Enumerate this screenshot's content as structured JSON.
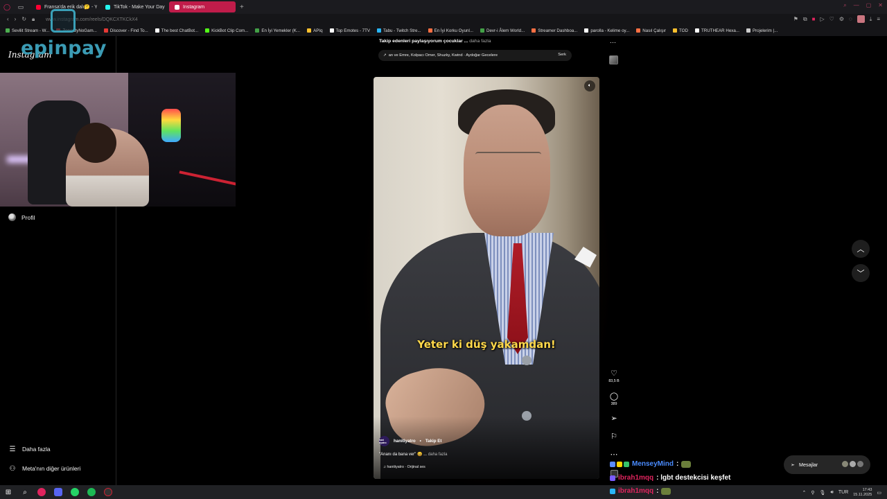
{
  "browser": {
    "tabs": [
      {
        "label": "Fransa'da erik dalı🤔 - Yo",
        "favicon_color": "#ff0033",
        "active": false
      },
      {
        "label": "TikTok - Make Your Day",
        "favicon_color": "#25f4ee",
        "active": false
      },
      {
        "label": "Instagram",
        "favicon_color": "#e1306c",
        "active": true
      }
    ],
    "new_tab": "+",
    "url": "www.instagram.com/reels/DQKCXTKCkX4",
    "bookmarks": [
      {
        "label": "Sevilit Stream - W...",
        "color": "#4caf50"
      },
      {
        "label": "Zone ByNoGam...",
        "color": "#e53935"
      },
      {
        "label": "Discover - Find To...",
        "color": "#e53935"
      },
      {
        "label": "The best ChatBot...",
        "color": "#ffffff"
      },
      {
        "label": "KickBot Clip Com...",
        "color": "#53fc18"
      },
      {
        "label": "En İyi Yemekler (K...",
        "color": "#43a047"
      },
      {
        "label": "APIq",
        "color": "#fbc02d"
      },
      {
        "label": "Top Emotes - 7TV",
        "color": "#ffffff"
      },
      {
        "label": "Tabu - Twitch Stre...",
        "color": "#29b6f6"
      },
      {
        "label": "En İyi Korku Oyunl...",
        "color": "#ff7043"
      },
      {
        "label": "Devr-i Âlem World...",
        "color": "#43a047"
      },
      {
        "label": "Streamer Dashboa...",
        "color": "#ff7043"
      },
      {
        "label": "parolla - Kelime oy...",
        "color": "#ffffff"
      },
      {
        "label": "Nasıl Çalışır",
        "color": "#ff7043"
      },
      {
        "label": "TOD",
        "color": "#fbc02d"
      },
      {
        "label": "TRUTHEAR Hexa...",
        "color": "#ffffff"
      },
      {
        "label": "Projelerim |...",
        "color": "#cccccc"
      }
    ]
  },
  "overlay": {
    "brand": "epinpay"
  },
  "sidebar": {
    "logo": "Instagram",
    "profile_label": "Profil",
    "more_label": "Daha fazla",
    "meta_label": "Meta'nın diğer ürünleri"
  },
  "post_above": {
    "caption": "Takip edenleri paylaşıyorum çocuklar ...",
    "more": "daha fazla",
    "audio": "an ve Emre, Kolpacı Omer, Shuzky, Kwind · Aydoğar Gecelere",
    "follow": "Serk"
  },
  "reel": {
    "subtitle": "Yeter ki düş yakamdan!",
    "author": "hanitiyatro",
    "author_avatar_text": "hani tiyatro",
    "dot": "•",
    "follow": "Takip Et",
    "caption": "\"Ananı da bana ver\" 😀 ...",
    "caption_more": "daha fazla",
    "audio": "hanitiyatro · Orijinal ses"
  },
  "actions": {
    "likes": "83,5 B",
    "comments": "389"
  },
  "messages": {
    "label": "Mesajlar"
  },
  "chat": [
    {
      "user": "MenseyMind",
      "user_color": "#4a8cff",
      "text": ":",
      "emote": true
    },
    {
      "user": "ibrah1mqq",
      "user_color": "#e0245e",
      "text": ": lgbt destekcisi keşfet",
      "emote": false
    },
    {
      "user": "ibrah1mqq",
      "user_color": "#e0245e",
      "text": ":",
      "emote": true
    }
  ],
  "taskbar": {
    "lang": "TUR",
    "time": "17:43",
    "date": "15.11.2025"
  }
}
